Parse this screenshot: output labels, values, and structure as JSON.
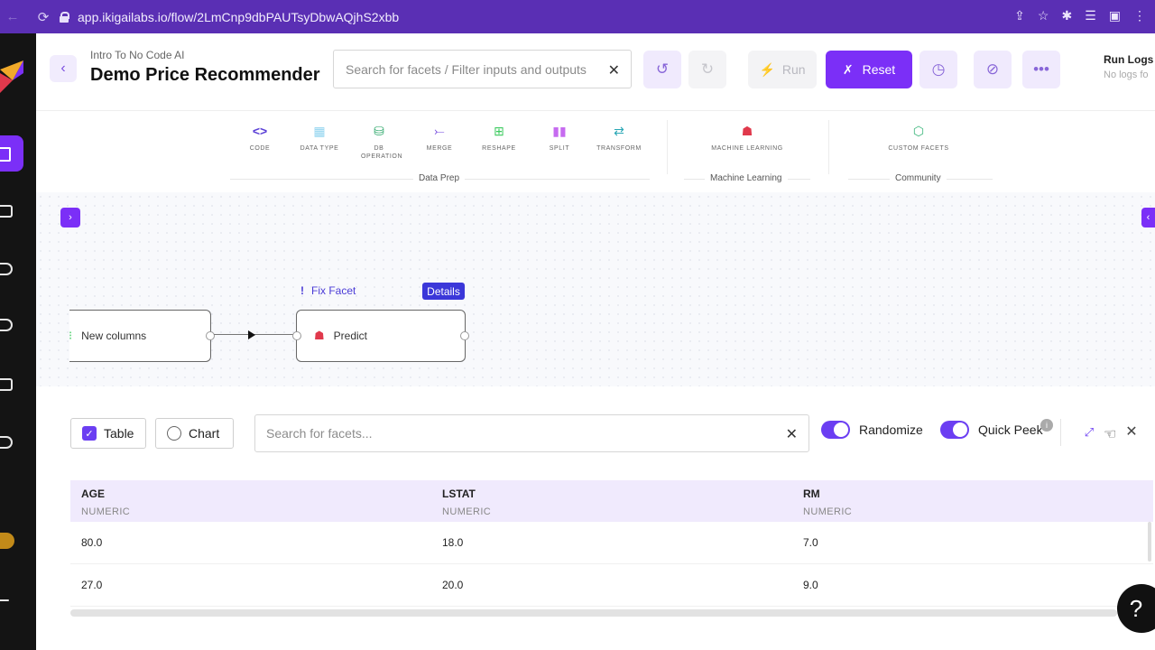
{
  "browser": {
    "back": "←",
    "forward": "→",
    "reload": "⟳",
    "url": "app.ikigailabs.io/flow/2LmCnp9dbPAUTsyDbwAQjhS2xbb"
  },
  "header": {
    "breadcrumb": "Intro To No Code AI",
    "title": "Demo Price Recommender",
    "search_placeholder": "Search for facets / Filter inputs and outputs",
    "run_label": "Run",
    "reset_label": "Reset",
    "run_logs_title": "Run Logs",
    "run_logs_sub": "No logs fo"
  },
  "facets": {
    "items": [
      {
        "label": "CODE",
        "icon": "code-icon",
        "color": "#5a3fd6"
      },
      {
        "label": "DATA TYPE",
        "icon": "grid-icon",
        "color": "#8fd3ef"
      },
      {
        "label": "DB OPERATION",
        "icon": "database-icon",
        "color": "#2ea86b"
      },
      {
        "label": "MERGE",
        "icon": "merge-icon",
        "color": "#6a3bdc"
      },
      {
        "label": "RESHAPE",
        "icon": "reshape-icon",
        "color": "#3ecb60"
      },
      {
        "label": "SPLIT",
        "icon": "split-icon",
        "color": "#c66bf0"
      },
      {
        "label": "TRANSFORM",
        "icon": "transform-icon",
        "color": "#2aa7b5"
      },
      {
        "label": "MACHINE LEARNING",
        "icon": "robot-icon",
        "color": "#e0394c"
      },
      {
        "label": "CUSTOM FACETS",
        "icon": "cube-icon",
        "color": "#3ab57a"
      }
    ],
    "groups": [
      "Data Prep",
      "Machine Learning",
      "Community"
    ]
  },
  "canvas": {
    "node1_label": "New columns",
    "node2_label": "Predict",
    "fix_facet": "Fix Facet",
    "details_label": "Details"
  },
  "panel": {
    "table_label": "Table",
    "chart_label": "Chart",
    "search_placeholder": "Search for facets...",
    "randomize_label": "Randomize",
    "quick_peek_label": "Quick Peek"
  },
  "table": {
    "columns": [
      {
        "name": "AGE",
        "type": "NUMERIC"
      },
      {
        "name": "LSTAT",
        "type": "NUMERIC"
      },
      {
        "name": "RM",
        "type": "NUMERIC"
      }
    ],
    "rows": [
      [
        "80.0",
        "18.0",
        "7.0"
      ],
      [
        "27.0",
        "20.0",
        "9.0"
      ]
    ]
  },
  "help_label": "?",
  "colors": {
    "brand": "#7b2ff7",
    "browser_bar": "#5a2fb4",
    "rail": "#141414"
  }
}
